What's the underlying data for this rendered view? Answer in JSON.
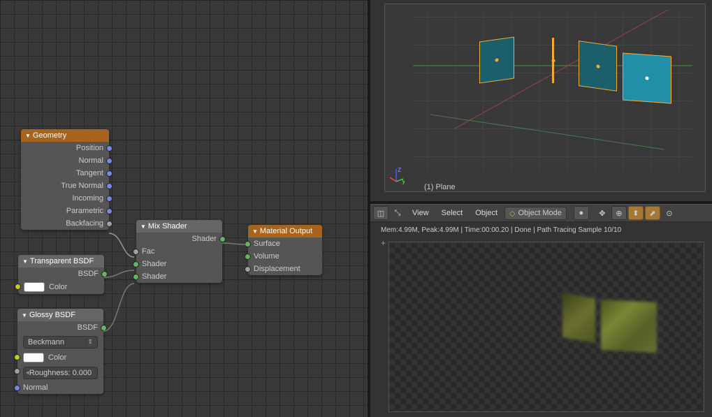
{
  "nodes": {
    "geometry": {
      "title": "Geometry",
      "outputs": [
        "Position",
        "Normal",
        "Tangent",
        "True Normal",
        "Incoming",
        "Parametric",
        "Backfacing"
      ]
    },
    "transparent": {
      "title": "Transparent BSDF",
      "out_bsdf": "BSDF",
      "color_label": "Color"
    },
    "glossy": {
      "title": "Glossy BSDF",
      "out_bsdf": "BSDF",
      "dist": "Beckmann",
      "color_label": "Color",
      "rough": "Roughness: 0.000",
      "normal_label": "Normal"
    },
    "mix": {
      "title": "Mix Shader",
      "out_shader": "Shader",
      "fac": "Fac",
      "in1": "Shader",
      "in2": "Shader"
    },
    "output": {
      "title": "Material Output",
      "surface": "Surface",
      "volume": "Volume",
      "disp": "Displacement"
    }
  },
  "viewport": {
    "object_label": "(1) Plane"
  },
  "header": {
    "view": "View",
    "select": "Select",
    "object": "Object",
    "mode": "Object Mode"
  },
  "status": "Mem:4.99M, Peak:4.99M | Time:00:00.20 | Done | Path Tracing Sample 10/10"
}
